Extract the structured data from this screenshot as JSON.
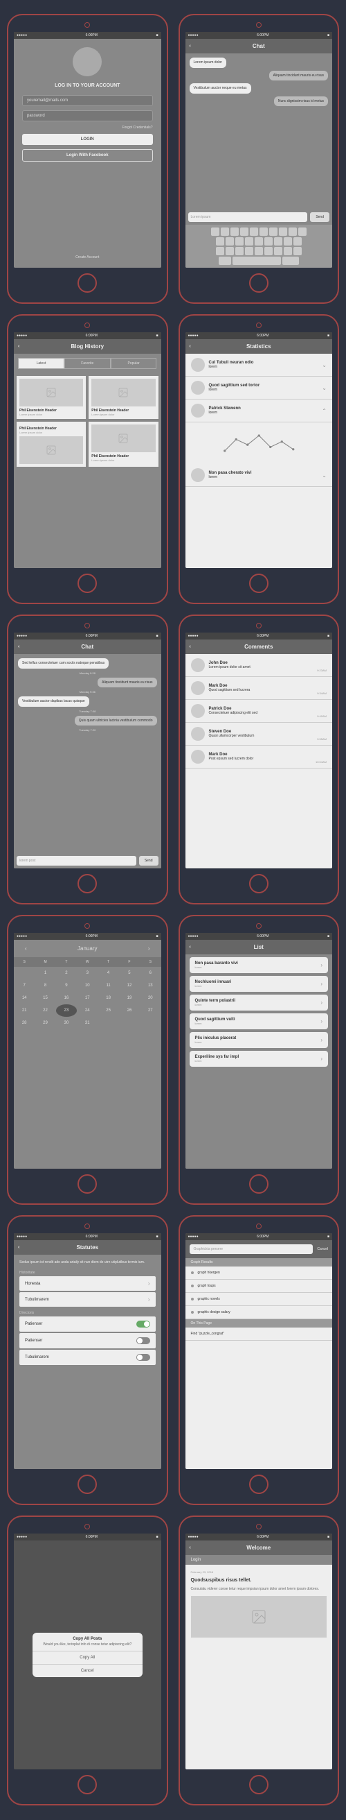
{
  "status": {
    "carrier": "●●●●●",
    "time": "6:00PM",
    "battery": "■"
  },
  "login": {
    "title": "LOG IN TO YOUR ACCOUNT",
    "email_ph": "youremail@mails.com",
    "pass_ph": "password",
    "forgot": "Forgot Credentials?",
    "login_btn": "LOGIN",
    "fb_btn": "Login With Facebook",
    "create": "Create Account"
  },
  "chat": {
    "title": "Chat",
    "msgs": [
      {
        "side": "L",
        "text": "Lorem ipsum dolor"
      },
      {
        "side": "R",
        "text": "Aliquam tincidunt mauris eu risus"
      },
      {
        "side": "L",
        "text": "Vestibulum auctor neque eu metus"
      },
      {
        "side": "R",
        "text": "Nunc dignissim risus id metus"
      }
    ],
    "input_ph": "Lorem ipsum",
    "send": "Send"
  },
  "blog": {
    "title": "Blog History",
    "tabs": [
      "Latest",
      "Favorite",
      "Popular"
    ],
    "cards": [
      {
        "t": "Phil Eisenstein Header",
        "s": "Lorem ipsum dolor"
      },
      {
        "t": "Phil Eisenstein Header",
        "s": "Lorem ipsum dolor"
      },
      {
        "t": "Phil Eisenstein Header",
        "s": "Lorem ipsum dolor"
      },
      {
        "t": "Phil Eisenstein Header",
        "s": "Lorem ipsum dolor"
      }
    ]
  },
  "stats": {
    "title": "Statistics",
    "rows": [
      {
        "t": "Cul Tubuli neuran odio",
        "s": "lorem"
      },
      {
        "t": "Quod sagittium sed tortor",
        "s": "lorem"
      },
      {
        "t": "Patrick Stewenn",
        "s": "lorem"
      },
      {
        "t": "Non pasa cherato vivi",
        "s": "lorem"
      }
    ]
  },
  "chat2": {
    "title": "Chat",
    "ts": "Monday 9:28",
    "msgs": [
      {
        "side": "L",
        "text": "Sed tellus consectetuer cum sociis natoque penatibus",
        "ts": "Monday 9:28"
      },
      {
        "side": "R",
        "text": "Aliquam tincidunt mauris eu risus",
        "ts": "Monday 9:36"
      },
      {
        "side": "L",
        "text": "Vestibulum auctor dapibus lacus quisque",
        "ts": "Tuesday 7:08"
      },
      {
        "side": "R",
        "text": "Quis quam ultricies lacinia vestibulum commodo",
        "ts": "Tuesday 7:20"
      }
    ],
    "input_ph": "lorem post",
    "send": "Send"
  },
  "comments": {
    "title": "Comments",
    "items": [
      {
        "n": "John Doe",
        "t": "Lorem ipsum dolor sit amet",
        "d": "9:23AM"
      },
      {
        "n": "Mark Doe",
        "t": "Quod sagittium sed lucrera",
        "d": "9:34AM"
      },
      {
        "n": "Patrick Doe",
        "t": "Consectetuer adipiscing elit sed",
        "d": "9:42AM"
      },
      {
        "n": "Steven Doe",
        "t": "Quasi ullamcorper vestibulum",
        "d": "9:55AM"
      },
      {
        "n": "Mark Doe",
        "t": "Post epsum sed lucrem dolor",
        "d": "10:04AM"
      }
    ]
  },
  "calendar": {
    "month": "January",
    "dow": [
      "S",
      "M",
      "T",
      "W",
      "T",
      "F",
      "S"
    ],
    "days": [
      [
        "",
        "1",
        "2",
        "3",
        "4",
        "5",
        "6"
      ],
      [
        "7",
        "8",
        "9",
        "10",
        "11",
        "12",
        "13"
      ],
      [
        "14",
        "15",
        "16",
        "17",
        "18",
        "19",
        "20"
      ],
      [
        "21",
        "22",
        "23",
        "24",
        "25",
        "26",
        "27"
      ],
      [
        "28",
        "29",
        "30",
        "31",
        "",
        "",
        ""
      ],
      [
        "",
        "",
        "",
        "",
        "",
        "",
        ""
      ]
    ],
    "selected": "23"
  },
  "list": {
    "title": "List",
    "items": [
      {
        "t": "Non pasa baranto vivi",
        "s": "lorem"
      },
      {
        "t": "Nochluomi innuari",
        "s": "lorem"
      },
      {
        "t": "Quinte term polastrii",
        "s": "lorem"
      },
      {
        "t": "Quod sagittium vulti",
        "s": "lorem"
      },
      {
        "t": "Plis iniculus placerat",
        "s": "lorem"
      },
      {
        "t": "Experiline sys far impl",
        "s": "lorem"
      }
    ]
  },
  "settings": {
    "title": "Statutes",
    "intro": "Sedus ipsum ist rendit ado anda artaily sit nun diem de utrn utiplutibus termis ium.",
    "g1": "Historitate",
    "r1": "Honesta",
    "r2": "Tubulimarem",
    "g2": "Directoris",
    "r3": "Patienser",
    "r4": "Patienser",
    "r5": "Tubulimarem"
  },
  "search": {
    "ph": "Graphickta persere",
    "cancel": "Cancel",
    "h1": "Graph Results",
    "res": [
      "graph hkergen",
      "graph loups",
      "graphic novels",
      "graphic design salary"
    ],
    "h2": "On This Page",
    "hint": "Find \"puzzle_congrat\""
  },
  "dialog": {
    "title": "Copy All Posts",
    "msg": "Would you like, terinplat info di conse tetur adipiscing elit?",
    "b1": "Copy All",
    "b2": "Cancel"
  },
  "article": {
    "nav": "Welcome",
    "tab": "Login",
    "date": "February 23, 2016",
    "title": "Quodsuspibus risus tellet.",
    "body": "Consulatu viderer conse tetur reque impsian ipsum dolor amet lorem ipsum dolores."
  }
}
